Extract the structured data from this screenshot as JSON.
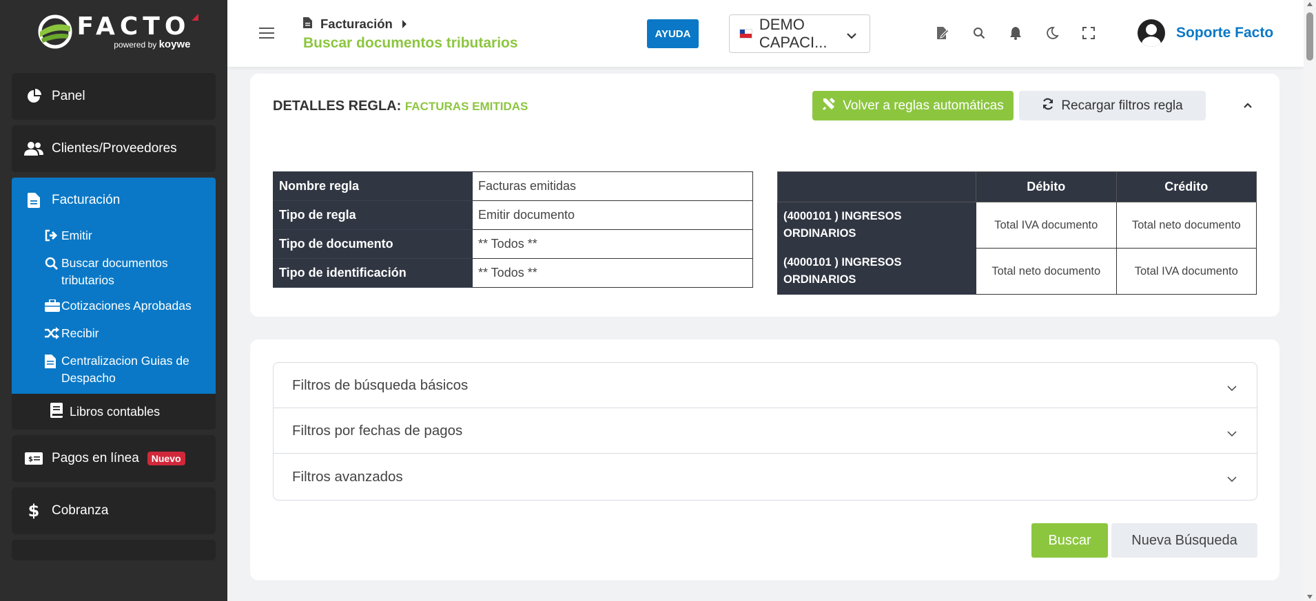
{
  "brand": {
    "name": "FACTO",
    "powered": "powered by",
    "partner": "koywe"
  },
  "sidebar": {
    "items": [
      {
        "label": "Panel",
        "icon": "pie-chart-icon"
      },
      {
        "label": "Clientes/Proveedores",
        "icon": "users-icon"
      },
      {
        "label": "Facturación",
        "icon": "document-icon"
      },
      {
        "label": "Pagos en línea",
        "icon": "money-icon",
        "badge": "Nuevo"
      },
      {
        "label": "Cobranza",
        "icon": "dollar-icon"
      }
    ],
    "sub_items": [
      {
        "label": "Emitir",
        "icon": "sign-out-icon"
      },
      {
        "label": "Buscar documentos tributarios",
        "icon": "search-icon"
      },
      {
        "label": "Cotizaciones Aprobadas",
        "icon": "briefcase-icon"
      },
      {
        "label": "Recibir",
        "icon": "shuffle-icon"
      },
      {
        "label": "Centralizacion Guias de Despacho",
        "icon": "file-icon"
      }
    ],
    "libros": "Libros contables"
  },
  "header": {
    "breadcrumb": "Facturación",
    "title": "Buscar documentos tributarios",
    "help": "AYUDA",
    "company": "DEMO CAPACI...",
    "user": "Soporte Facto"
  },
  "rule": {
    "title": "DETALLES REGLA:",
    "name_highlight": "FACTURAS EMITIDAS",
    "back_button": "Volver a reglas automáticas",
    "reload_button": "Recargar filtros regla",
    "details": [
      {
        "label": "Nombre regla",
        "value": "Facturas emitidas"
      },
      {
        "label": "Tipo de regla",
        "value": "Emitir documento"
      },
      {
        "label": "Tipo de documento",
        "value": "** Todos **"
      },
      {
        "label": "Tipo de identificación",
        "value": "** Todos **"
      }
    ],
    "accounts_headers": [
      "",
      "Débito",
      "Crédito"
    ],
    "accounts": [
      {
        "account": "(4000101 ) INGRESOS ORDINARIOS",
        "debito": "Total IVA documento",
        "credito": "Total neto documento"
      },
      {
        "account": "(4000101 ) INGRESOS ORDINARIOS",
        "debito": "Total neto documento",
        "credito": "Total IVA documento"
      }
    ]
  },
  "filters": {
    "sections": [
      "Filtros de búsqueda básicos",
      "Filtros por fechas de pagos",
      "Filtros avanzados"
    ],
    "search_button": "Buscar",
    "new_search_button": "Nueva Búsqueda"
  },
  "colors": {
    "primary": "#0a78c6",
    "accent_green": "#8cc63f",
    "sidebar": "#2d2d2d",
    "table_header": "#303642",
    "badge_red": "#d0283a"
  }
}
